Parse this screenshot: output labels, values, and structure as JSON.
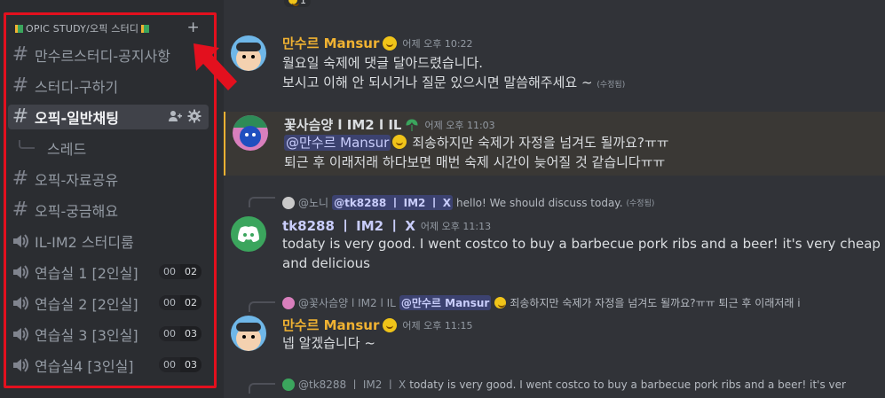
{
  "server": {
    "category": "OPIC STUDY/오픽 스터디",
    "add_label": "+"
  },
  "sidebar": {
    "channels": [
      {
        "type": "text",
        "label": "만수르스터디-공지사항",
        "active": false
      },
      {
        "type": "text",
        "label": "스터디-구하기",
        "active": false
      },
      {
        "type": "text",
        "label": "오픽-일반채팅",
        "active": true
      },
      {
        "type": "thread",
        "label": "스레드",
        "active": false
      },
      {
        "type": "text",
        "label": "오픽-자료공유",
        "active": false
      },
      {
        "type": "text",
        "label": "오픽-궁금해요",
        "active": false
      },
      {
        "type": "voice",
        "label": "IL-IM2 스터디룸",
        "active": false
      },
      {
        "type": "voice",
        "label": "연습실 1 [2인실]",
        "count": "00",
        "limit": "02"
      },
      {
        "type": "voice",
        "label": "연습실 2 [2인실]",
        "count": "00",
        "limit": "02"
      },
      {
        "type": "voice",
        "label": "연습실 3 [3인실]",
        "count": "00",
        "limit": "03"
      },
      {
        "type": "voice",
        "label": "연습실4 [3인실]",
        "count": "00",
        "limit": "03"
      }
    ]
  },
  "chat": {
    "top_reaction_count": "1",
    "messages": [
      {
        "author": "만수르 Mansur",
        "timestamp": "어제 오후 10:22",
        "lines": [
          "월요일 숙제에 댓글 달아드렸습니다.",
          "보시고 이해 안 되시거나 질문 있으시면 말씀해주세요 ~"
        ],
        "edited": "(수정됨)"
      },
      {
        "author": "꽃사슴양 l IM2 l IL",
        "timestamp": "어제 오후 11:03",
        "mention": "@만수르 Mansur",
        "lines": [
          "죄송하지만 숙제가 자정을 넘겨도 될까요?ㅠㅠ",
          "퇴근 후 이래저래 하다보면 매번 숙제 시간이 늦어질 것 같습니다ㅠㅠ"
        ]
      },
      {
        "reply": {
          "author": "@노니",
          "mention": "@tk8288 ㅣ IM2 ㅣ X",
          "text": "hello! We should discuss today.",
          "edited": "(수정됨)"
        },
        "author": "tk8288 ㅣ IM2 ㅣ X",
        "timestamp": "어제 오후 11:13",
        "lines": [
          "todaty is very good. I went costco to buy a barbecue pork ribs and a beer! it's very cheap",
          "and delicious"
        ]
      },
      {
        "reply": {
          "author": "@꽃사슴양 l IM2 l IL",
          "mention": "@만수르 Mansur",
          "text": "죄송하지만 숙제가 자정을 넘겨도 될까요?ㅠㅠ 퇴근 후 이래저래 i"
        },
        "author": "만수르 Mansur",
        "timestamp": "어제 오후 11:15",
        "lines": [
          "넵 알겠습니다 ~"
        ]
      },
      {
        "reply": {
          "author": "@tk8288 ㅣ IM2 ㅣ X",
          "text": "todaty is very good. I went costco to buy a barbecue pork ribs and a beer! it's ver"
        }
      }
    ]
  },
  "colors": {
    "accent_red": "#e3101e",
    "mansur_name": "#f0b232",
    "deer_name": "#dbdee1",
    "tk_name": "#c9cdfb",
    "discord_green": "#3ba55d",
    "highlight_bar": "#f0b132"
  },
  "icons": [
    "hash-icon",
    "speaker-icon",
    "thread-icon",
    "add-member-icon",
    "gear-icon",
    "plus-icon",
    "book-icon",
    "discord-icon",
    "red-arrow-icon"
  ]
}
